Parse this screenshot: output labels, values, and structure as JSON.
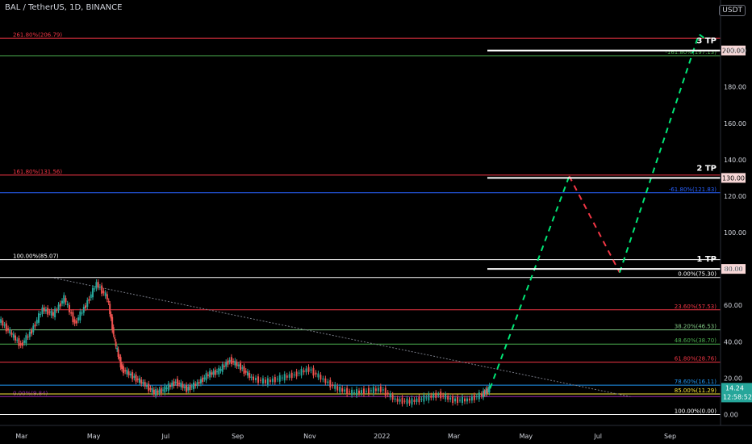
{
  "header": {
    "title": "BAL / TetherUS, 1D, BINANCE",
    "currency": "USDT"
  },
  "chart_data": {
    "type": "candlestick",
    "ylim": [
      -6,
      218
    ],
    "y_ticks": [
      0,
      20,
      40,
      60,
      80,
      100,
      120,
      140,
      160,
      180,
      200
    ],
    "y_tick_labels": [
      "0.00",
      "20.00",
      "40.00",
      "60.00",
      "80.00",
      "100.00",
      "120.00",
      "140.00",
      "160.00",
      "180.00",
      "200.00"
    ],
    "x_tick_labels": [
      {
        "label": "Mar",
        "t": 0.6
      },
      {
        "label": "May",
        "t": 2.6
      },
      {
        "label": "Jul",
        "t": 4.6
      },
      {
        "label": "Sep",
        "t": 6.6
      },
      {
        "label": "Nov",
        "t": 8.6
      },
      {
        "label": "2022",
        "t": 10.6
      },
      {
        "label": "Mar",
        "t": 12.6
      },
      {
        "label": "May",
        "t": 14.6
      },
      {
        "label": "Jul",
        "t": 16.6
      },
      {
        "label": "Sep",
        "t": 18.6
      }
    ],
    "x_range": [
      0,
      20
    ],
    "price_path": [
      [
        0,
        52
      ],
      [
        0.3,
        45
      ],
      [
        0.6,
        38
      ],
      [
        0.9,
        46
      ],
      [
        1.2,
        58
      ],
      [
        1.5,
        55
      ],
      [
        1.8,
        64
      ],
      [
        2.1,
        50
      ],
      [
        2.4,
        60
      ],
      [
        2.7,
        72
      ],
      [
        3.0,
        64
      ],
      [
        3.2,
        40
      ],
      [
        3.4,
        25
      ],
      [
        3.7,
        21
      ],
      [
        4.0,
        17
      ],
      [
        4.3,
        12
      ],
      [
        4.6,
        14
      ],
      [
        4.9,
        18
      ],
      [
        5.2,
        14
      ],
      [
        5.5,
        17
      ],
      [
        5.8,
        22
      ],
      [
        6.1,
        24
      ],
      [
        6.4,
        30
      ],
      [
        6.7,
        26
      ],
      [
        7.0,
        20
      ],
      [
        7.4,
        18
      ],
      [
        7.8,
        20
      ],
      [
        8.2,
        22
      ],
      [
        8.6,
        25
      ],
      [
        9.0,
        19
      ],
      [
        9.4,
        14
      ],
      [
        9.8,
        12
      ],
      [
        10.2,
        13
      ],
      [
        10.6,
        14
      ],
      [
        11.0,
        8
      ],
      [
        11.4,
        7
      ],
      [
        11.8,
        9
      ],
      [
        12.2,
        11
      ],
      [
        12.6,
        8
      ],
      [
        13.0,
        8
      ],
      [
        13.4,
        11
      ],
      [
        13.6,
        14.24
      ]
    ],
    "fib_levels": [
      {
        "label": "261.80%(206.79)",
        "value": 206.79,
        "color": "#f23645",
        "label_side": "left"
      },
      {
        "label": "161.80%(131.56)",
        "value": 131.56,
        "color": "#f23645",
        "label_side": "left"
      },
      {
        "label": "100.00%(85.07)",
        "value": 85.07,
        "color": "#ffffff",
        "label_side": "left"
      },
      {
        "label": "0.00%(9.84)",
        "value": 9.84,
        "color": "#9c27b0",
        "label_side": "left"
      },
      {
        "label": "-61.80%(121.83)",
        "value": 121.83,
        "color": "#2962ff",
        "label_side": "right"
      },
      {
        "label": "0.00%(75.30)",
        "value": 75.3,
        "color": "#ffffff",
        "label_side": "right"
      },
      {
        "label": "23.60%(57.53)",
        "value": 57.53,
        "color": "#f23645",
        "label_side": "right"
      },
      {
        "label": "38.20%(46.53)",
        "value": 46.53,
        "color": "#81c784",
        "label_side": "right"
      },
      {
        "label": "48.60%(38.70)",
        "value": 38.7,
        "color": "#4caf50",
        "label_side": "right"
      },
      {
        "label": "61.80%(28.76)",
        "value": 28.76,
        "color": "#f23645",
        "label_side": "right"
      },
      {
        "label": "78.60%(16.11)",
        "value": 16.11,
        "color": "#2196f3",
        "label_side": "right"
      },
      {
        "label": "85.00%(11.29)",
        "value": 11.29,
        "color": "#ffeb3b",
        "label_side": "right"
      },
      {
        "label": "100.00%(0.00)",
        "value": 0,
        "color": "#ffffff",
        "label_side": "right"
      },
      {
        "label": "-161.80%(197.13)",
        "value": 197.13,
        "color": "#4caf50",
        "label_side": "right"
      }
    ],
    "targets": [
      {
        "label": "3 TP",
        "value": 200,
        "price_label": "200.00"
      },
      {
        "label": "2 TP",
        "value": 130,
        "price_label": "130.00"
      },
      {
        "label": "1 TP",
        "value": 80,
        "price_label": "80.00"
      }
    ],
    "projection": [
      {
        "points": [
          [
            13.6,
            14.24
          ],
          [
            15.8,
            131
          ]
        ],
        "color": "#00e676"
      },
      {
        "points": [
          [
            15.8,
            131
          ],
          [
            17.2,
            78
          ]
        ],
        "color": "#f23645"
      },
      {
        "points": [
          [
            17.2,
            78
          ],
          [
            19.4,
            209
          ],
          [
            19.6,
            206
          ]
        ],
        "color": "#00e676"
      }
    ],
    "trendline": {
      "points": [
        [
          1.5,
          75
        ],
        [
          17.5,
          9.8
        ]
      ],
      "color": "#787b86"
    },
    "last_price": {
      "value": 14.24,
      "label": "14.24",
      "countdown": "12:58:52",
      "color": "#26a69a"
    }
  }
}
